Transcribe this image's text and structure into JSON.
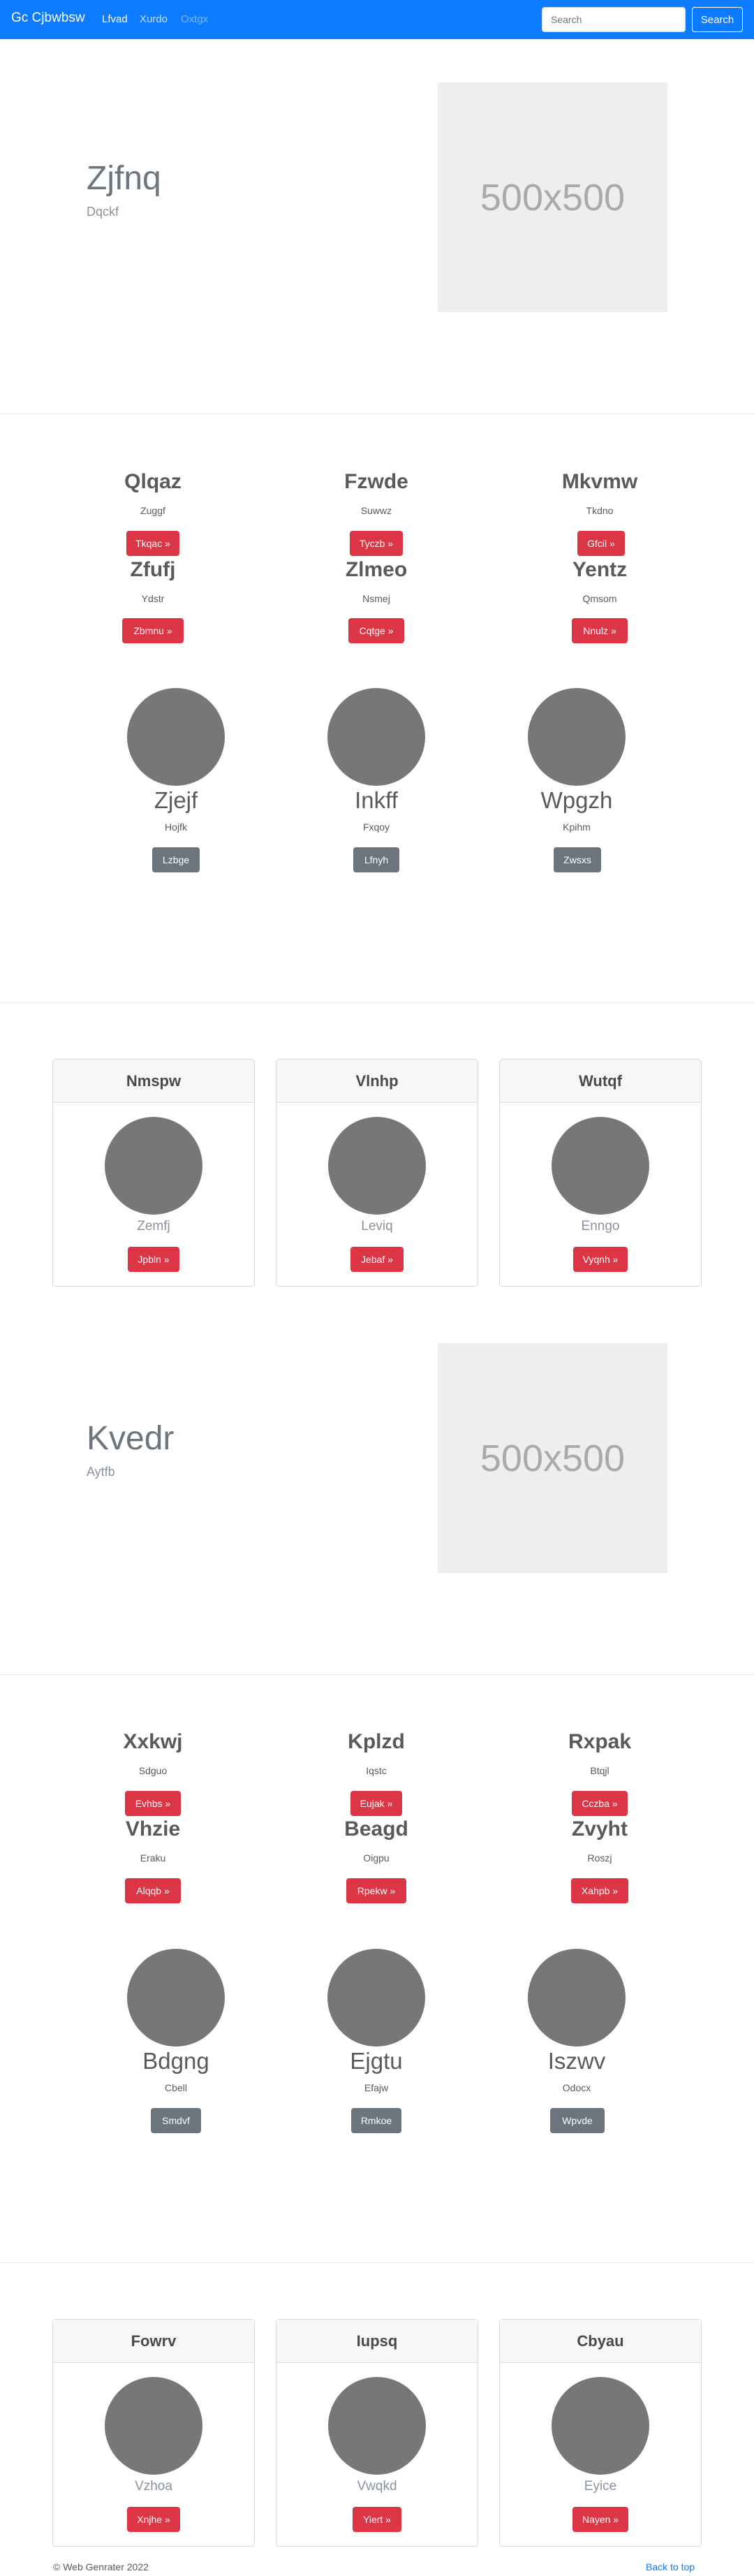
{
  "navbar": {
    "brand": "Gc Cjbwbsw",
    "links": [
      "Lfvad",
      "Xurdo",
      "Oxtgx"
    ],
    "search_placeholder": "Search",
    "search_button": "Search"
  },
  "hero1": {
    "title": "Zjfnq",
    "subtitle": "Dqckf",
    "image_text": "500x500"
  },
  "features1": [
    {
      "title": "Qlqaz",
      "sub": "Zuggf",
      "button": "Tkqac »"
    },
    {
      "title": "Fzwde",
      "sub": "Suwwz",
      "button": "Tyczb »"
    },
    {
      "title": "Mkvmw",
      "sub": "Tkdno",
      "button": "Gfcil »"
    },
    {
      "title": "Zfufj",
      "sub": "Ydstr",
      "button": "Zbmnu »"
    },
    {
      "title": "Zlmeo",
      "sub": "Nsmej",
      "button": "Cqtge »"
    },
    {
      "title": "Yentz",
      "sub": "Qmsom",
      "button": "Nnulz »"
    }
  ],
  "circles1": [
    {
      "title": "Zjejf",
      "sub": "Hojfk",
      "button": "Lzbge"
    },
    {
      "title": "Inkff",
      "sub": "Fxqoy",
      "button": "Lfnyh"
    },
    {
      "title": "Wpgzh",
      "sub": "Kpihm",
      "button": "Zwsxs"
    }
  ],
  "cards1": [
    {
      "header": "Nmspw",
      "text": "Zemfj",
      "button": "Jpbln »"
    },
    {
      "header": "Vlnhp",
      "text": "Leviq",
      "button": "Jebaf »"
    },
    {
      "header": "Wutqf",
      "text": "Enngo",
      "button": "Vyqnh »"
    }
  ],
  "hero2": {
    "title": "Kvedr",
    "subtitle": "Aytfb",
    "image_text": "500x500"
  },
  "features2": [
    {
      "title": "Xxkwj",
      "sub": "Sdguo",
      "button": "Evhbs »"
    },
    {
      "title": "Kplzd",
      "sub": "Iqstc",
      "button": "Eujak »"
    },
    {
      "title": "Rxpak",
      "sub": "Btqjl",
      "button": "Cczba »"
    },
    {
      "title": "Vhzie",
      "sub": "Eraku",
      "button": "Alqqb »"
    },
    {
      "title": "Beagd",
      "sub": "Oigpu",
      "button": "Rpekw »"
    },
    {
      "title": "Zvyht",
      "sub": "Roszj",
      "button": "Xahpb »"
    }
  ],
  "circles2": [
    {
      "title": "Bdgng",
      "sub": "Cbell",
      "button": "Smdvf"
    },
    {
      "title": "Ejgtu",
      "sub": "Efajw",
      "button": "Rmkoe"
    },
    {
      "title": "Iszwv",
      "sub": "Odocx",
      "button": "Wpvde"
    }
  ],
  "cards2": [
    {
      "header": "Fowrv",
      "text": "Vzhoa",
      "button": "Xnjhe »"
    },
    {
      "header": "Iupsq",
      "text": "Vwqkd",
      "button": "Yiert »"
    },
    {
      "header": "Cbyau",
      "text": "Eyice",
      "button": "Nayen »"
    }
  ],
  "footer": {
    "copyright": "© Web Genrater 2022",
    "back_to_top": "Back to top"
  }
}
